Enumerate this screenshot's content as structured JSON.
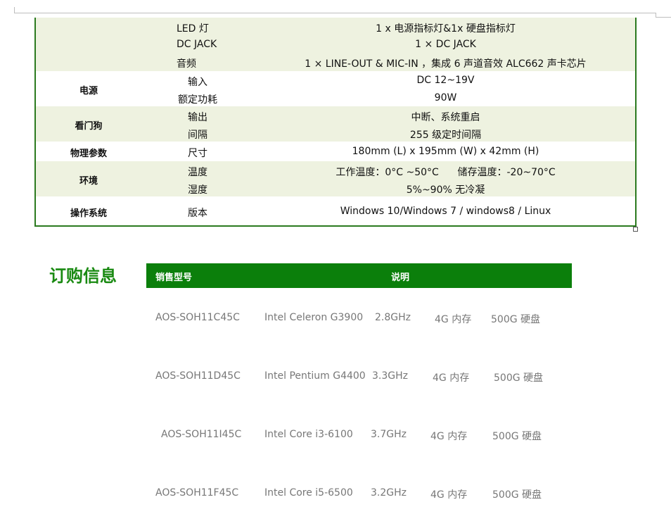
{
  "spec_rows": [
    {
      "category": "",
      "label": "LED 灯",
      "value": "1 x 电源指标灯&1x 硬盘指标灯"
    },
    {
      "category": "",
      "label": "DC JACK",
      "value": "1 × DC JACK"
    },
    {
      "category": "",
      "label": "音频",
      "value": "1 × LINE-OUT & MIC-IN ，集成 6 声道音效 ALC662 声卡芯片"
    },
    {
      "category": "电源",
      "label": "输入",
      "value": "DC 12~19V"
    },
    {
      "category": "",
      "label": "额定功耗",
      "value": "90W"
    },
    {
      "category": "看门狗",
      "label": "输出",
      "value": "中断、系统重启"
    },
    {
      "category": "",
      "label": "间隔",
      "value": "255 级定时间隔"
    },
    {
      "category": "物理参数",
      "label": "尺寸",
      "value": "180mm (L) x 195mm (W) x 42mm (H)"
    },
    {
      "category": "环境",
      "label": "温度",
      "value": "工作温度：0°C ~50°C      储存温度：-20~70°C"
    },
    {
      "category": "",
      "label": "湿度",
      "value": "5%~90% 无冷凝"
    },
    {
      "category": "操作系统",
      "label": "版本",
      "value": "Windows 10/Windows 7 / windows8 / Linux"
    }
  ],
  "order": {
    "title": "订购信息",
    "header_model": "销售型号",
    "header_desc": "说明",
    "rows": [
      {
        "model": "AOS-SOH11C45C",
        "cpu": "Intel Celeron G3900",
        "freq": "2.8GHz",
        "mem": "4G 内存",
        "disk": "500G 硬盘"
      },
      {
        "model": "AOS-SOH11D45C",
        "cpu": "Intel Pentium G4400",
        "freq": "3.3GHz",
        "mem": "4G 内存",
        "disk": "500G 硬盘"
      },
      {
        "model": "AOS-SOH11I45C",
        "cpu": "Intel Core i3-6100",
        "freq": "3.7GHz",
        "mem": "4G 内存",
        "disk": "500G 硬盘"
      },
      {
        "model": "AOS-SOH11F45C",
        "cpu": "Intel Core i5-6500",
        "freq": "3.2GHz",
        "mem": "4G 内存",
        "disk": "500G 硬盘"
      }
    ]
  }
}
